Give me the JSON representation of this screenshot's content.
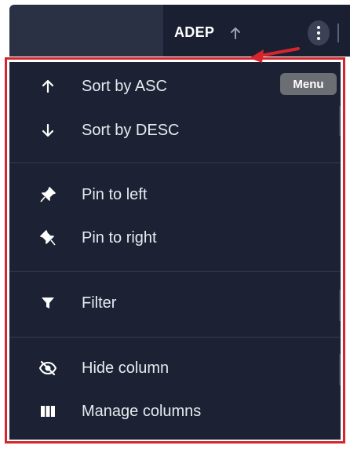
{
  "header": {
    "column_title": "ADEP",
    "sort_indicator_icon": "arrow-up-icon",
    "menu_button_icon": "kebab-menu-icon"
  },
  "tooltip": {
    "text": "Menu"
  },
  "menu": {
    "items": [
      {
        "label": "Sort by ASC",
        "icon": "arrow-up-icon"
      },
      {
        "label": "Sort by DESC",
        "icon": "arrow-down-icon"
      },
      {
        "label": "Pin to left",
        "icon": "pin-left-icon"
      },
      {
        "label": "Pin to right",
        "icon": "pin-right-icon"
      },
      {
        "label": "Filter",
        "icon": "filter-icon"
      },
      {
        "label": "Hide column",
        "icon": "eye-off-icon"
      },
      {
        "label": "Manage columns",
        "icon": "columns-icon"
      }
    ]
  },
  "colors": {
    "menu_background": "#1c2233",
    "header_background": "#1a2032",
    "highlight": "#d6252c",
    "text": "#e8eaf0",
    "tooltip_background": "#6b6e73"
  }
}
